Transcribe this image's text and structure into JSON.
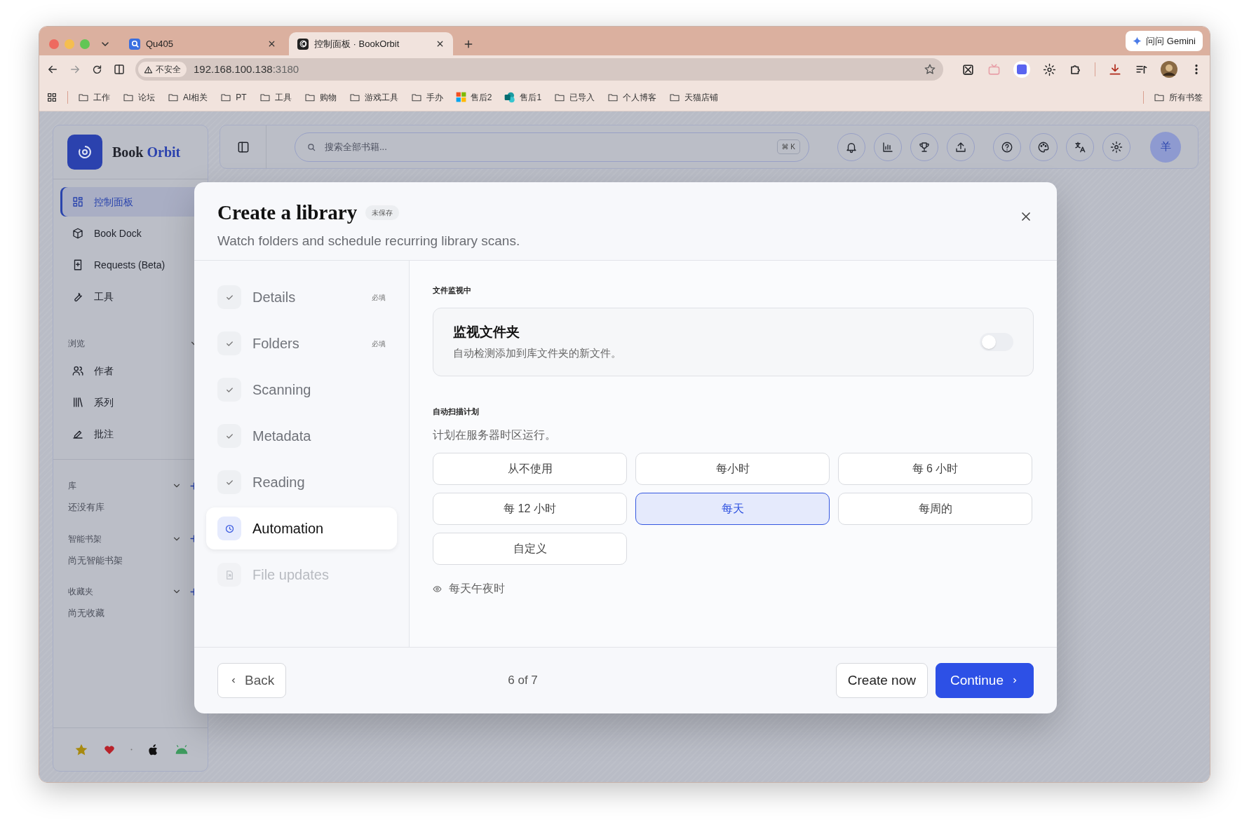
{
  "browser": {
    "tabs": [
      {
        "title": "Qu405",
        "selected": false
      },
      {
        "title": "控制面板 · BookOrbit",
        "selected": true
      }
    ],
    "gemini": "问问 Gemini",
    "security": "不安全",
    "url_host": "192.168.100.138",
    "url_port": ":3180",
    "bookmarks": [
      {
        "label": "工作",
        "kind": "folder"
      },
      {
        "label": "论坛",
        "kind": "folder"
      },
      {
        "label": "AI相关",
        "kind": "folder"
      },
      {
        "label": "PT",
        "kind": "folder"
      },
      {
        "label": "工具",
        "kind": "folder"
      },
      {
        "label": "购物",
        "kind": "folder"
      },
      {
        "label": "游戏工具",
        "kind": "folder"
      },
      {
        "label": "手办",
        "kind": "folder"
      },
      {
        "label": "售后2",
        "kind": "tiles"
      },
      {
        "label": "售后1",
        "kind": "app"
      },
      {
        "label": "已导入",
        "kind": "folder"
      },
      {
        "label": "个人博客",
        "kind": "folder"
      },
      {
        "label": "天猫店铺",
        "kind": "folder"
      }
    ],
    "all_bookmarks": "所有书签"
  },
  "app": {
    "logo": {
      "first": "Book",
      "second": "Orbit"
    },
    "search": {
      "placeholder": "搜索全部书籍...",
      "shortcut": "⌘ K"
    },
    "avatar": "羊",
    "nav": [
      {
        "label": "控制面板",
        "selected": true
      },
      {
        "label": "Book Dock",
        "selected": false
      },
      {
        "label": "Requests (Beta)",
        "selected": false
      },
      {
        "label": "工具",
        "selected": false
      }
    ],
    "sections": [
      {
        "title": "浏览",
        "addable": false,
        "items": [
          {
            "label": "作者"
          },
          {
            "label": "系列"
          },
          {
            "label": "批注"
          }
        ]
      },
      {
        "title": "库",
        "addable": true,
        "empty": "还没有库"
      },
      {
        "title": "智能书架",
        "addable": true,
        "empty": "尚无智能书架"
      },
      {
        "title": "收藏夹",
        "addable": true,
        "empty": "尚无收藏"
      }
    ]
  },
  "modal": {
    "title": "Create a library",
    "badge": "未保存",
    "subtitle": "Watch folders and schedule recurring library scans.",
    "steps": [
      {
        "label": "Details",
        "required": "必填",
        "completed": true,
        "selected": false,
        "disabled": false
      },
      {
        "label": "Folders",
        "required": "必填",
        "completed": true,
        "selected": false,
        "disabled": false
      },
      {
        "label": "Scanning",
        "completed": true,
        "selected": false,
        "disabled": false
      },
      {
        "label": "Metadata",
        "completed": true,
        "selected": false,
        "disabled": false
      },
      {
        "label": "Reading",
        "completed": true,
        "selected": false,
        "disabled": false
      },
      {
        "label": "Automation",
        "completed": false,
        "selected": true,
        "disabled": false
      },
      {
        "label": "File updates",
        "completed": false,
        "selected": false,
        "disabled": true
      }
    ],
    "watch": {
      "section": "文件监视中",
      "title": "监视文件夹",
      "description": "自动检测添加到库文件夹的新文件。",
      "on": false
    },
    "schedule": {
      "section": "自动扫描计划",
      "hint": "计划在服务器时区运行。",
      "options": [
        {
          "label": "从不使用",
          "selected": false
        },
        {
          "label": "每小时",
          "selected": false
        },
        {
          "label": "每 6 小时",
          "selected": false
        },
        {
          "label": "每 12 小时",
          "selected": false
        },
        {
          "label": "每天",
          "selected": true
        },
        {
          "label": "每周的",
          "selected": false
        },
        {
          "label": "自定义",
          "selected": false
        }
      ],
      "summary": "每天午夜时"
    },
    "back": "Back",
    "progress": "6 of 7",
    "create": "Create now",
    "next": "Continue"
  }
}
